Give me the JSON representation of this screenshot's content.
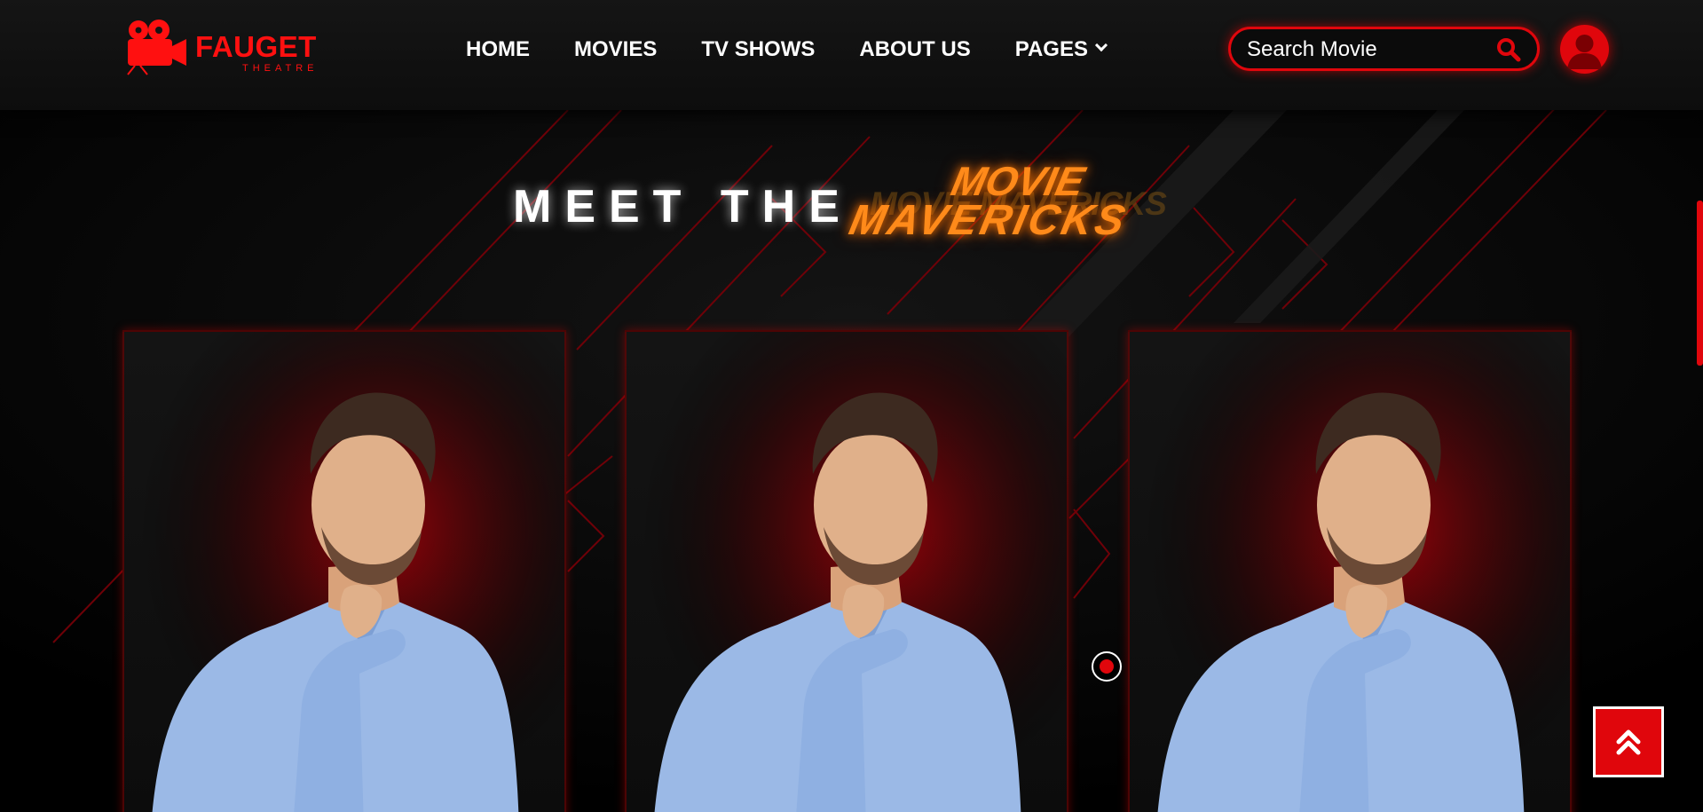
{
  "brand": {
    "name": "FAUGET",
    "tagline": "THEATRE"
  },
  "nav": {
    "items": [
      {
        "label": "HOME",
        "has_dropdown": false
      },
      {
        "label": "MOVIES",
        "has_dropdown": false
      },
      {
        "label": "TV SHOWS",
        "has_dropdown": false
      },
      {
        "label": "ABOUT US",
        "has_dropdown": false
      },
      {
        "label": "PAGES",
        "has_dropdown": true
      }
    ]
  },
  "search": {
    "placeholder": "Search Movie",
    "value": ""
  },
  "hero": {
    "heading_prefix": "MEET THE",
    "heading_ghost": "MOVIE MAVERICKS",
    "heading_line1": "MOVIE",
    "heading_line2": "MAVERICKS"
  },
  "team": {
    "cards": [
      {
        "photo": "thinking-man-photo"
      },
      {
        "photo": "thinking-man-photo"
      },
      {
        "photo": "thinking-man-photo"
      }
    ]
  },
  "icons": {
    "logo": "film-camera-icon",
    "search": "search-icon",
    "user": "user-icon",
    "back_to_top": "double-chevron-up-icon",
    "scroll": "scroll-indicator"
  },
  "colors": {
    "accent": "#e0060c",
    "background": "#000000",
    "header": "#121212",
    "heading_gradient": "#ff8a1a",
    "shirt": "#9bb9e6"
  }
}
